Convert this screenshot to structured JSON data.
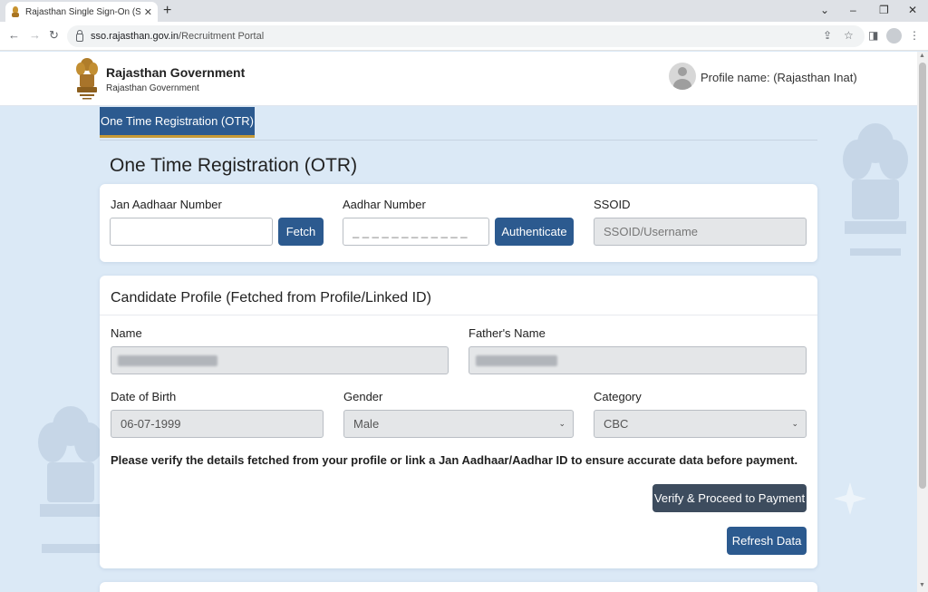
{
  "browser": {
    "tab_title": "Rajasthan Single Sign-On (SSO)",
    "tab_close": "✕",
    "new_tab": "+",
    "url_domain": "sso.rajasthan.gov.in",
    "url_path": "/Recruitment Portal"
  },
  "header": {
    "title": "Rajasthan Government",
    "subtitle": "Rajasthan Government",
    "profile": "Profile name: (Rajasthan Inat)"
  },
  "nav": {
    "active_tab": "One Time Registration (OTR)"
  },
  "page_title": "One Time Registration (OTR)",
  "id_section": {
    "jan_aadhaar_label": "Jan Aadhaar Number",
    "jan_aadhaar_value": "",
    "fetch_button": "Fetch",
    "aadhar_label": "Aadhar Number",
    "aadhar_placeholder": "_ _ _ _ _ _ _ _ _ _ _ _",
    "authenticate_button": "Authenticate",
    "ssoid_label": "SSOID",
    "ssoid_placeholder": "SSOID/Username"
  },
  "profile_section": {
    "heading": "Candidate Profile (Fetched from Profile/Linked ID)",
    "name_label": "Name",
    "father_label": "Father's Name",
    "dob_label": "Date of Birth",
    "dob_value": "06-07-1999",
    "gender_label": "Gender",
    "gender_value": "Male",
    "category_label": "Category",
    "category_value": "CBC",
    "notice": "Please verify the details fetched from your profile or link a Jan Aadhaar/Aadhar ID to ensure accurate data before payment.",
    "verify_button": "Verify & Proceed to Payment",
    "refresh_button": "Refresh Data"
  },
  "colors": {
    "primary": "#2c5a8f",
    "dark_button": "#3d4c5e",
    "accent_gold": "#c69a36",
    "page_bg": "#dbe9f6"
  }
}
